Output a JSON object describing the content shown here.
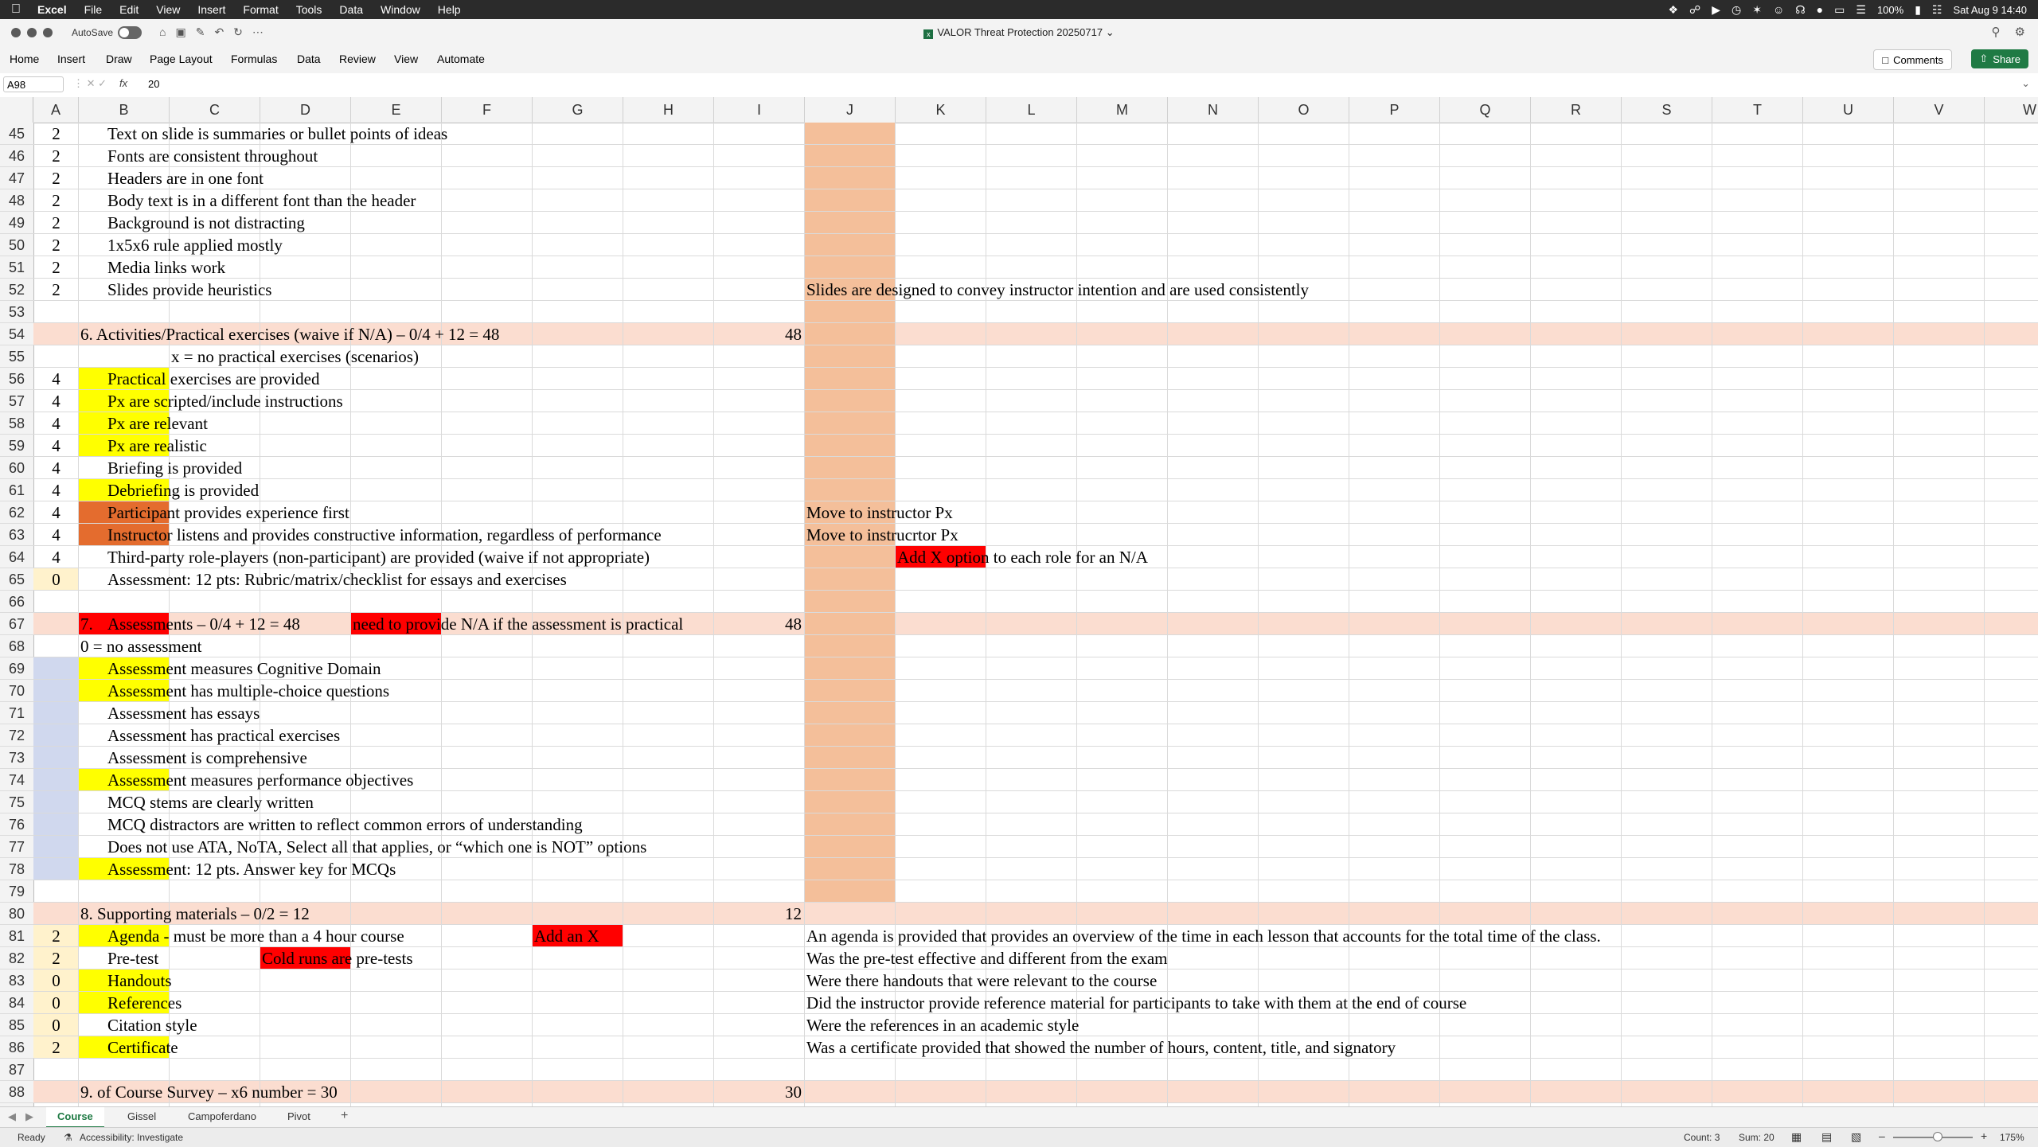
{
  "menubar": {
    "app": "Excel",
    "items": [
      "File",
      "Edit",
      "View",
      "Insert",
      "Format",
      "Tools",
      "Data",
      "Window",
      "Help"
    ],
    "battery": "100%",
    "clock": "Sat Aug 9  14:40"
  },
  "titlebar": {
    "autosave_label": "AutoSave",
    "doc_title": "VALOR Threat Protection 20250717"
  },
  "ribbon": {
    "tabs": [
      "Home",
      "Insert",
      "Draw",
      "Page Layout",
      "Formulas",
      "Data",
      "Review",
      "View",
      "Automate"
    ],
    "comments_label": "Comments",
    "share_label": "Share"
  },
  "formula_bar": {
    "name_box": "A98",
    "value": "20"
  },
  "columns": [
    "A",
    "B",
    "C",
    "D",
    "E",
    "F",
    "G",
    "H",
    "I",
    "J",
    "K",
    "L",
    "M",
    "N",
    "O",
    "P",
    "Q",
    "R",
    "S",
    "T",
    "U",
    "V",
    "W"
  ],
  "rows": [
    "45",
    "46",
    "47",
    "48",
    "49",
    "50",
    "51",
    "52",
    "53",
    "54",
    "55",
    "56",
    "57",
    "58",
    "59",
    "60",
    "61",
    "62",
    "63",
    "64",
    "65",
    "66",
    "67",
    "68",
    "69",
    "70",
    "71",
    "72",
    "73",
    "74",
    "75",
    "76",
    "77",
    "78",
    "79",
    "80",
    "81",
    "82",
    "83",
    "84",
    "85",
    "86",
    "87",
    "88"
  ],
  "cells": {
    "a": [
      "2",
      "2",
      "2",
      "2",
      "2",
      "2",
      "2",
      "2",
      "",
      "",
      "",
      "4",
      "4",
      "4",
      "4",
      "4",
      "4",
      "4",
      "4",
      "4",
      "0",
      "",
      "",
      "",
      "",
      "",
      "",
      "",
      "",
      "",
      "",
      "",
      "",
      "",
      "",
      "",
      "2",
      "2",
      "0",
      "0",
      "0",
      "2",
      "",
      ""
    ],
    "b_text": {
      "45": "Text on slide is summaries or bullet points of ideas",
      "46": "Fonts are consistent throughout",
      "47": "Headers are in one font",
      "48": "Body text is in a different font than the header",
      "49": "Background is not distracting",
      "50": "1x5x6 rule applied mostly",
      "51": "Media links work",
      "52": "Slides provide heuristics",
      "55": "x = no practical exercises (scenarios)",
      "56": "Practical exercises are provided",
      "57": "Px are scripted/include instructions",
      "58": "Px are relevant",
      "59": "Px are realistic",
      "60": "Briefing is provided",
      "61": "Debriefing is provided",
      "62": "Participant provides experience first",
      "63": "Instructor listens and provides constructive information, regardless of performance",
      "64": "Third-party role-players (non-participant) are provided (waive if not appropriate)",
      "65": "Assessment: 12 pts: Rubric/matrix/checklist for essays and exercises",
      "68": "0 = no assessment",
      "69": "Assessment measures Cognitive Domain",
      "70": "Assessment has multiple-choice questions",
      "71": "Assessment has essays",
      "72": "Assessment has practical exercises",
      "73": "Assessment is comprehensive",
      "74": "Assessment measures performance objectives",
      "75": "MCQ stems are clearly written",
      "76": "MCQ distractors are written to reflect common errors of understanding",
      "77": "Does not use ATA, NoTA, Select all that applies, or “which one is NOT” options",
      "78": "Assessment: 12 pts. Answer key for MCQs",
      "81": "Agenda - must be more than a 4 hour course",
      "82": "Pre-test",
      "83": "Handouts",
      "84": "References",
      "85": "Citation style",
      "86": "Certificate"
    },
    "headers": {
      "54": "6. Activities/Practical exercises (waive if N/A) – 0/4 + 12 = 48",
      "67_num": "7.",
      "67": "Assessments – 0/4 + 12 = 48",
      "67_note": "need to provide N/A if the assessment is practical",
      "80": "8.  Supporting materials – 0/2 = 12",
      "88": "9. of Course Survey – x6 number = 30"
    },
    "i_values": {
      "54": "48",
      "67": "48",
      "80": "12",
      "88": "30"
    },
    "j_notes": {
      "52": "Slides are designed to convey instructor intention and are used consistently",
      "62": "Move to instructor Px",
      "63": "Move to instrucrtor Px",
      "81": "An agenda is provided that provides an overview of the time in each lesson that accounts for the total time of the class.",
      "82": "Was the pre-test effective and different from the exam",
      "83": "Were there handouts that were relevant to the course",
      "84": "Did the instructor provide reference material for participants to take with them at the end of course",
      "85": "Were the references in an academic style",
      "86": "Was a certificate provided that showed the number of hours, content, title, and signatory"
    },
    "red_notes": {
      "64": "Add X option to each role for an N/A",
      "81": "Add an X",
      "82": "Cold runs are pre-tests"
    }
  },
  "sheets": [
    "Course",
    "Gissel",
    "Campoferdano",
    "Pivot"
  ],
  "status": {
    "ready": "Ready",
    "accessibility": "Accessibility: Investigate",
    "count": "Count: 3",
    "sum": "Sum: 20",
    "zoom": "175%"
  },
  "colors": {
    "yellow": "#ffff00",
    "red": "#ff0000",
    "orange_dark": "#e46c2e",
    "peach_header": "#fbddd0",
    "peach_column": "#f4bf9a",
    "cream": "#fff2cc",
    "lavender": "#d0d8ee",
    "excel_green": "#1f7a44"
  }
}
